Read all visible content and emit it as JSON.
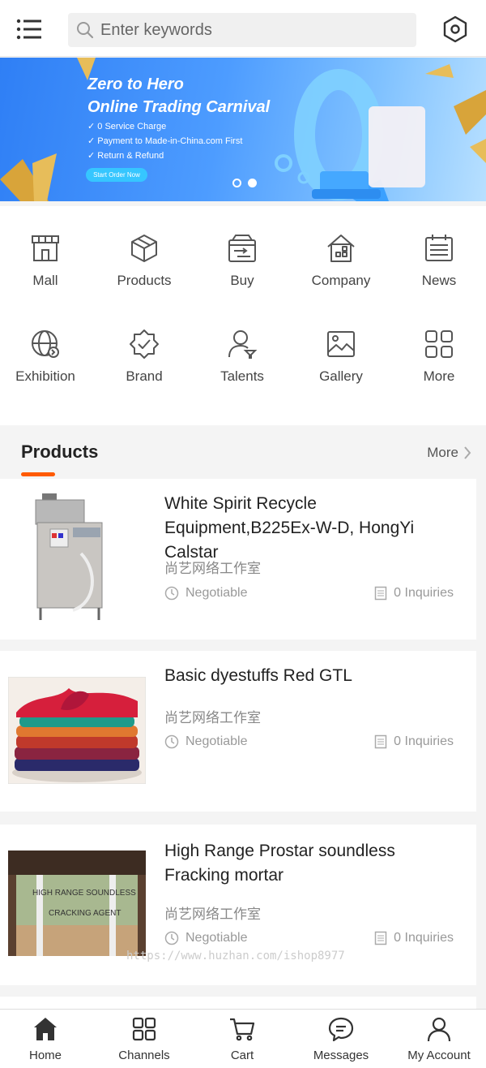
{
  "header": {
    "search_placeholder": "Enter keywords",
    "menu_icon": "hamburger-icon",
    "scan_icon": "hexagon-settings-icon"
  },
  "banner": {
    "title_line1": "Zero to Hero",
    "title_line2": "Online Trading Carnival",
    "bullets": [
      "0 Service Charge",
      "Payment to Made-in-China.com First",
      "Return & Refund"
    ],
    "cta": "Start Order Now",
    "active_slide": 2,
    "slide_count": 2
  },
  "categories": [
    {
      "label": "Mall",
      "icon": "storefront-icon"
    },
    {
      "label": "Products",
      "icon": "box-icon"
    },
    {
      "label": "Buy",
      "icon": "buy-transfer-icon"
    },
    {
      "label": "Company",
      "icon": "building-icon"
    },
    {
      "label": "News",
      "icon": "newspaper-icon"
    },
    {
      "label": "Exhibition",
      "icon": "globe-icon"
    },
    {
      "label": "Brand",
      "icon": "badge-check-icon"
    },
    {
      "label": "Talents",
      "icon": "person-icon"
    },
    {
      "label": "Gallery",
      "icon": "image-icon"
    },
    {
      "label": "More",
      "icon": "grid-icon"
    }
  ],
  "products_section": {
    "title": "Products",
    "more": "More",
    "accent_color": "#ff5a00"
  },
  "products": [
    {
      "title": "White Spirit Recycle Equipment,B225Ex-W-D, HongYi Calstar",
      "company": "尚艺网络工作室",
      "price": "Negotiable",
      "inquiries": "0 Inquiries"
    },
    {
      "title": "Basic dyestuffs Red GTL",
      "company": "尚艺网络工作室",
      "price": "Negotiable",
      "inquiries": "0 Inquiries"
    },
    {
      "title": "High Range Prostar soundless Fracking mortar",
      "company": "尚艺网络工作室",
      "price": "Negotiable",
      "inquiries": "0 Inquiries"
    }
  ],
  "watermark": "https://www.huzhan.com/ishop8977",
  "tabbar": [
    {
      "label": "Home",
      "icon": "home-icon"
    },
    {
      "label": "Channels",
      "icon": "grid-icon"
    },
    {
      "label": "Cart",
      "icon": "cart-icon"
    },
    {
      "label": "Messages",
      "icon": "chat-icon"
    },
    {
      "label": "My Account",
      "icon": "user-icon"
    }
  ]
}
